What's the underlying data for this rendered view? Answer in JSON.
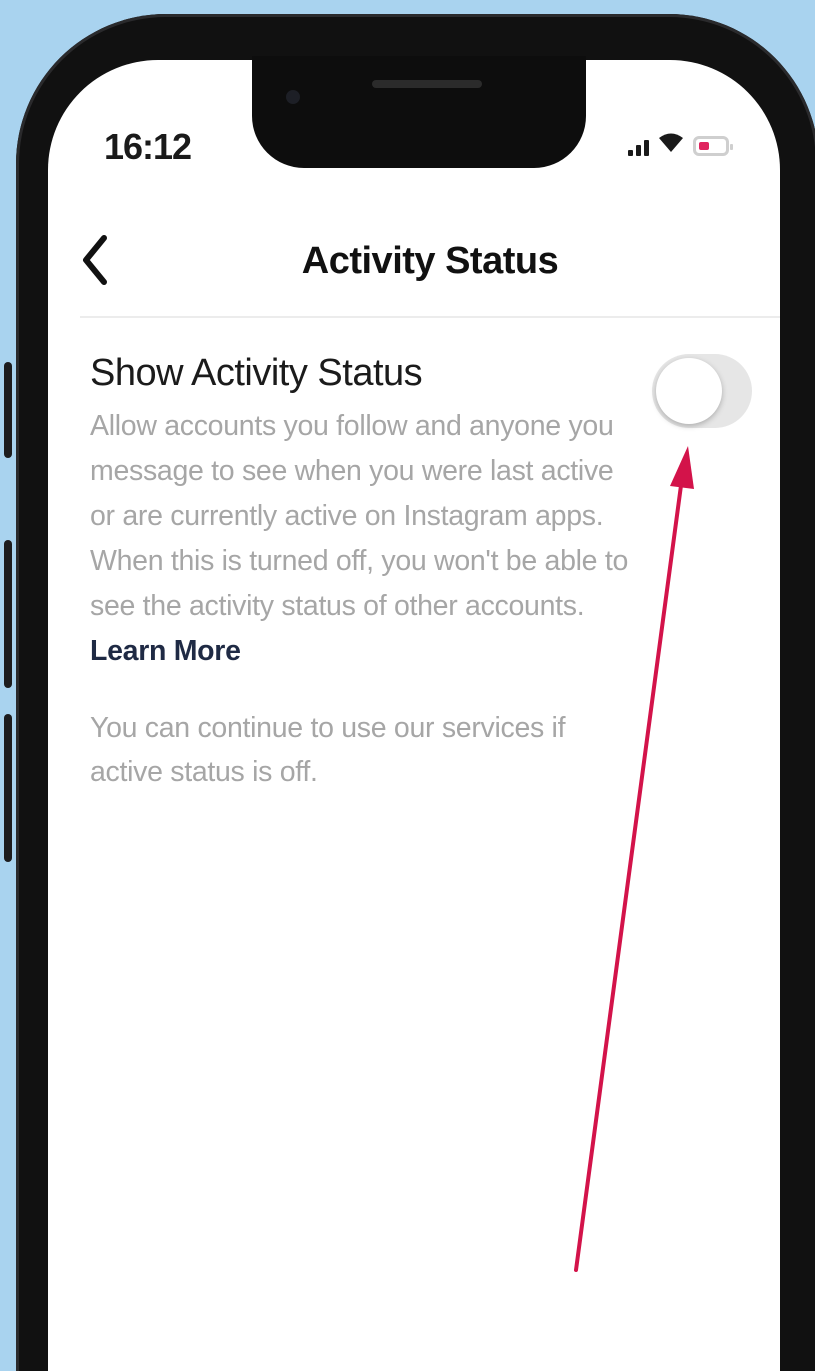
{
  "status_bar": {
    "time": "16:12",
    "icons": [
      "signal-icon",
      "wifi-icon",
      "battery-icon"
    ]
  },
  "header": {
    "back_icon": "chevron-left-icon",
    "title": "Activity Status"
  },
  "setting": {
    "label": "Show Activity Status",
    "description": "Allow accounts you follow and anyone you message to see when you were last active or are currently active on Instagram apps. When this is turned off, you won't be able to see the activity status of other accounts.",
    "learn_more": "Learn More",
    "toggle_on": false
  },
  "note": "You can continue to use our services if active status is off.",
  "colors": {
    "background": "#a9d3ef",
    "annotation_arrow": "#d3134a",
    "toggle_off": "#e6e6e6",
    "battery_charge": "#e0245e"
  }
}
